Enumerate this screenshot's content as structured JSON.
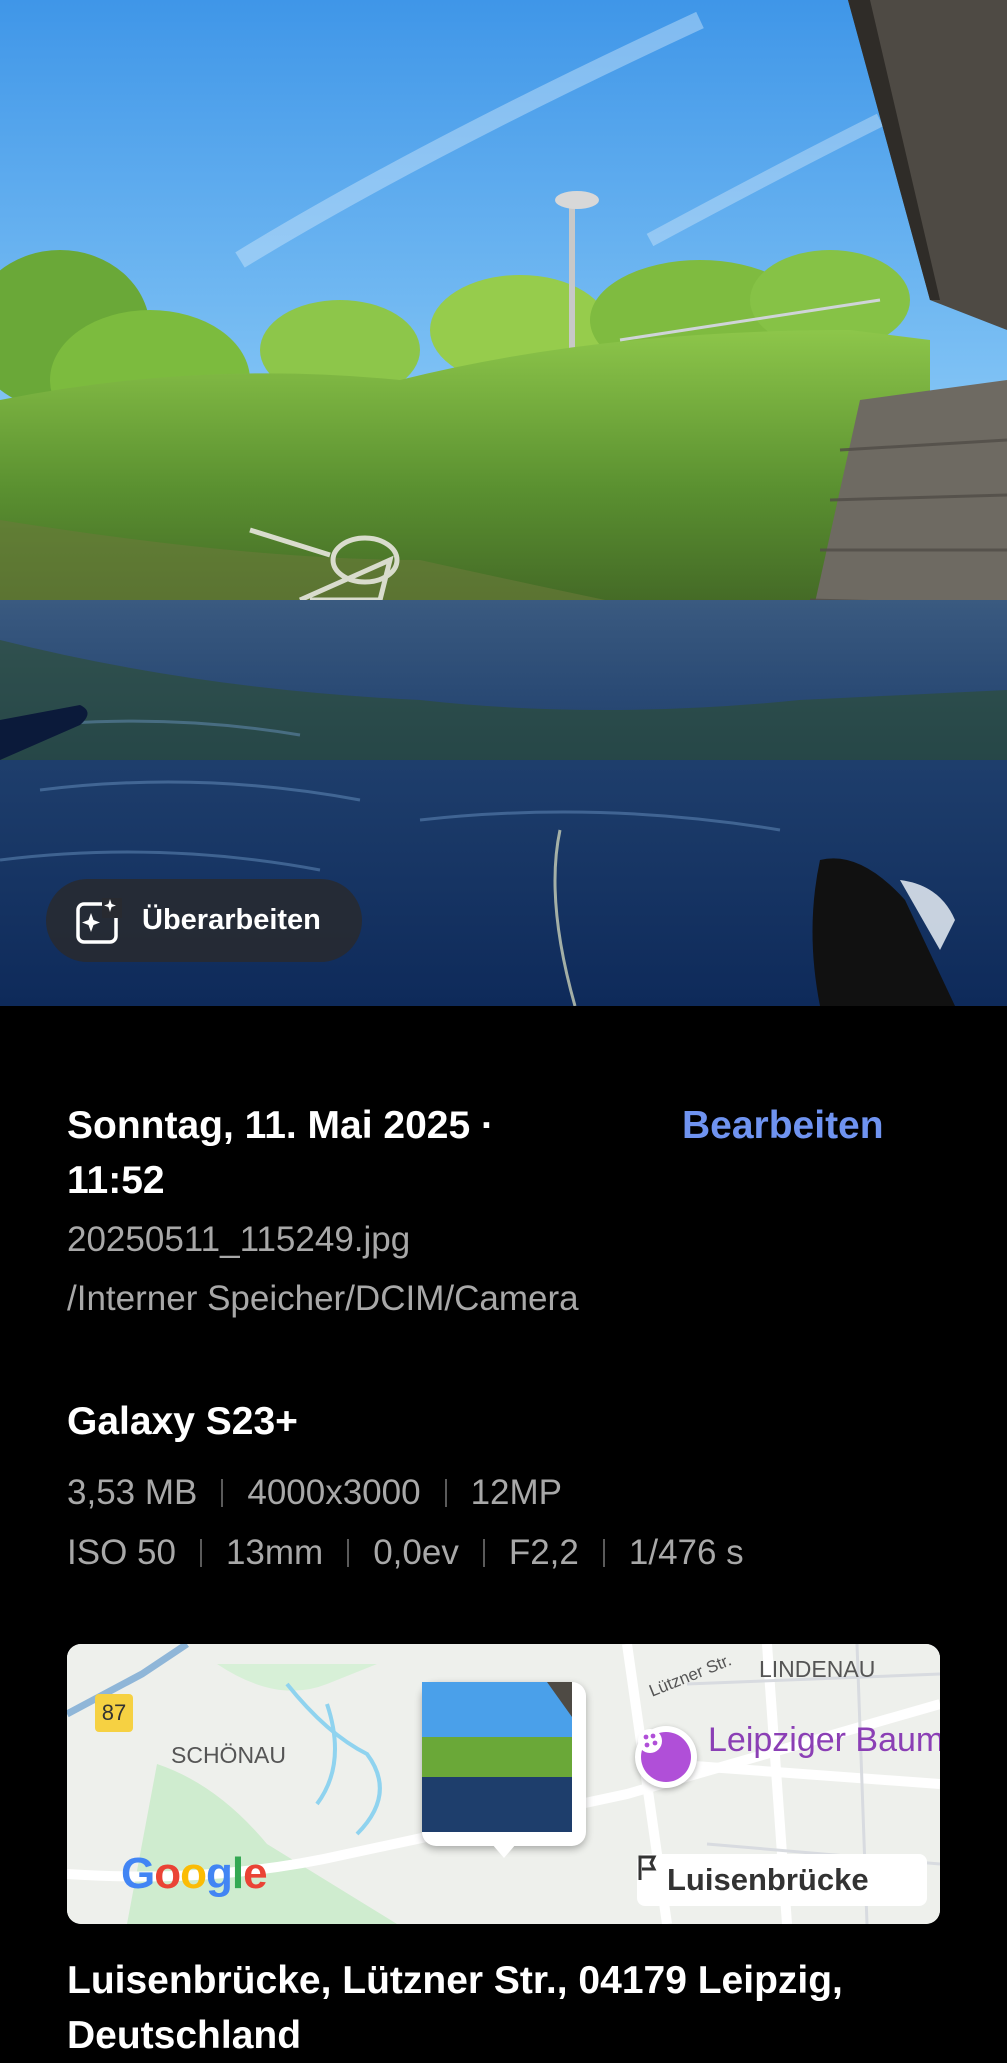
{
  "photo": {
    "enhance_button_label": "Überarbeiten",
    "enhance_icon": "sparkle-frame-icon"
  },
  "details": {
    "date_line": "Sonntag, 11. Mai 2025 · 11:52",
    "edit_label": "Bearbeiten",
    "filename": "20250511_115249.jpg",
    "filepath": "/Interner Speicher/DCIM/Camera",
    "device": "Galaxy S23+",
    "specs_row1": [
      "3,53 MB",
      "4000x3000",
      "12MP"
    ],
    "specs_row2": [
      "ISO 50",
      "13mm",
      "0,0ev",
      "F2,2",
      "1/476 s"
    ]
  },
  "map": {
    "road_number": "87",
    "area_labels": [
      "SCHÖNAU",
      "LINDENAU"
    ],
    "street_label": "Lützner Str.",
    "poi_name": "Leipziger Baumwollspin",
    "provider_logo": "Google",
    "place_chip": "Luisenbrücke"
  },
  "address": "Luisenbrücke, Lützner Str., 04179 Leipzig, Deutschland",
  "colors": {
    "accent": "#6f93f0",
    "background": "#000000",
    "secondary_text": "#a8a8a8",
    "poi": "#8b3fb5"
  }
}
